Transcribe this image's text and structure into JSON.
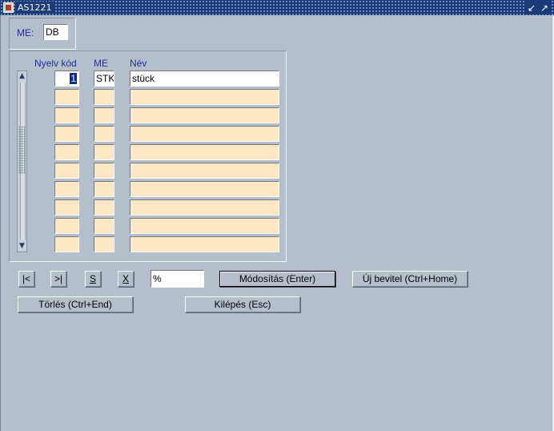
{
  "window": {
    "title": "AS1221",
    "min_icon": "minimize-icon",
    "max_icon": "maximize-icon"
  },
  "me_field": {
    "label": "ME:",
    "value": "DB"
  },
  "grid": {
    "headers": {
      "code": "Nyelv kód",
      "me": "ME",
      "name": "Név"
    },
    "rows": [
      {
        "code": "1",
        "me": "STK",
        "name": "stück"
      },
      {
        "code": "",
        "me": "",
        "name": ""
      },
      {
        "code": "",
        "me": "",
        "name": ""
      },
      {
        "code": "",
        "me": "",
        "name": ""
      },
      {
        "code": "",
        "me": "",
        "name": ""
      },
      {
        "code": "",
        "me": "",
        "name": ""
      },
      {
        "code": "",
        "me": "",
        "name": ""
      },
      {
        "code": "",
        "me": "",
        "name": ""
      },
      {
        "code": "",
        "me": "",
        "name": ""
      },
      {
        "code": "",
        "me": "",
        "name": ""
      }
    ]
  },
  "toolbar": {
    "first_label": "|<",
    "last_label": ">|",
    "s_label": "S",
    "x_label": "X",
    "filter_value": "%",
    "modify_label": "Módosítás (Enter)",
    "new_label": "Új bevitel (Ctrl+Home)",
    "delete_label": "Törlés (Ctrl+End)",
    "exit_label": "Kilépés (Esc)"
  },
  "colors": {
    "background": "#b4bfcb",
    "field": "#fce8c4",
    "title_bar": "#1b3a7a",
    "header_text": "#1f2f9e",
    "selection": "#0a2a8c"
  }
}
